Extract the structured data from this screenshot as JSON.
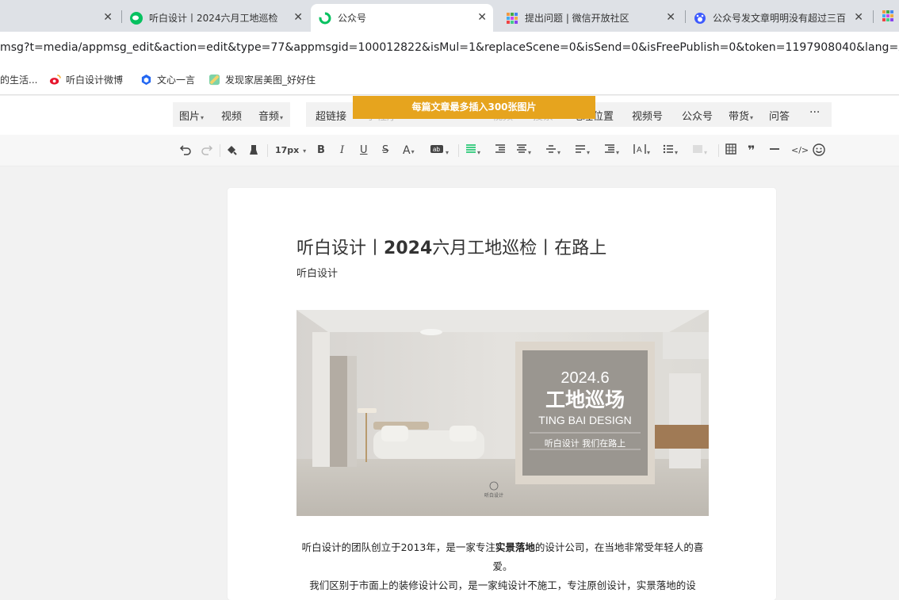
{
  "tabs": [
    {
      "title": "",
      "active": false
    },
    {
      "title": "听白设计丨2024六月工地巡检",
      "active": false
    },
    {
      "title": "公众号",
      "active": true
    },
    {
      "title": "提出问题 | 微信开放社区",
      "active": false
    },
    {
      "title": "公众号发文章明明没有超过三百",
      "active": false
    }
  ],
  "address": {
    "url": "msg?t=media/appmsg_edit&action=edit&type=77&appmsgid=100012822&isMul=1&replaceScene=0&isSend=0&isFreePublish=0&token=1197908040&lang=zh_CN&"
  },
  "bookmarks": [
    "的生活...",
    "听白设计微博",
    "文心一言",
    "发现家居美图_好好住"
  ],
  "toolbar": {
    "media": [
      "图片",
      "视频",
      "音频"
    ],
    "insert": [
      "超链接",
      "小程序",
      "...",
      "视频",
      "搜索",
      "地理位置",
      "视频号",
      "公众号",
      "带货",
      "问答"
    ],
    "more": "···",
    "font_size": "17px",
    "banner": "每篇文章最多插入300张图片"
  },
  "article": {
    "title_pre": "听白设计丨",
    "title_bold": "2024",
    "title_post": "六月工地巡检丨在路上",
    "author": "听白设计",
    "cover": {
      "date": "2024.6",
      "heading": "工地巡场",
      "brand": "TING BAI DESIGN",
      "slogan": "听白设计 我们在路上",
      "logo": "听白设计"
    },
    "p1_pre": "听白设计的团队创立于2013年，是一家专注",
    "p1_bold": "实景落地",
    "p1_post": "的设计公司，在当地非常受年轻人的喜爱。",
    "p2": "我们区别于市面上的装修设计公司，是一家纯设计不施工，专注原创设计，实景落地的设"
  }
}
